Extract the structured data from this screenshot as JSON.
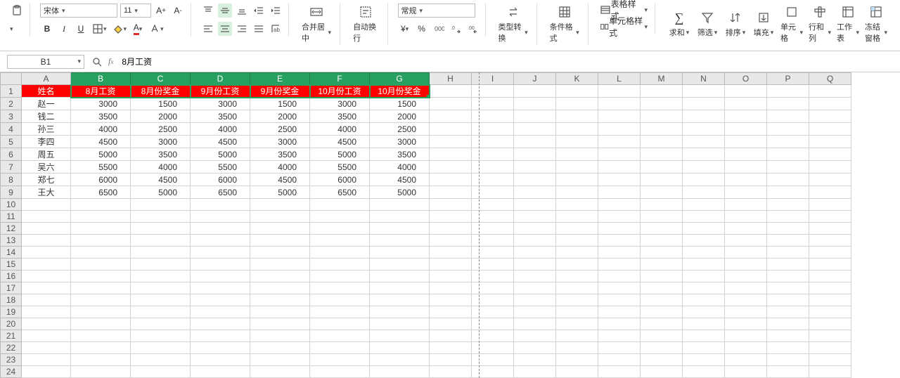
{
  "toolbar": {
    "font_name": "宋体",
    "font_size": "11",
    "number_format": "常规",
    "merge_center": "合并居中",
    "wrap_text": "自动换行",
    "type_convert": "类型转换",
    "cond_format": "条件格式",
    "table_style": "表格样式",
    "cell_style": "单元格样式",
    "sum": "求和",
    "filter": "筛选",
    "sort": "排序",
    "fill": "填充",
    "cell": "单元格",
    "row_col": "行和列",
    "worksheet": "工作表",
    "freeze": "冻结窗格"
  },
  "namebox": {
    "ref": "B1"
  },
  "formula": {
    "value": "8月工资"
  },
  "columns": [
    "A",
    "B",
    "C",
    "D",
    "E",
    "F",
    "G",
    "H",
    "I",
    "J",
    "K",
    "L",
    "M",
    "N",
    "O",
    "P",
    "Q"
  ],
  "headerRow": [
    "姓名",
    "8月工资",
    "8月份奖金",
    "9月份工资",
    "9月份奖金",
    "10月份工资",
    "10月份奖金"
  ],
  "rows": [
    {
      "name": "赵一",
      "v": [
        3000,
        1500,
        3000,
        1500,
        3000,
        1500
      ]
    },
    {
      "name": "钱二",
      "v": [
        3500,
        2000,
        3500,
        2000,
        3500,
        2000
      ]
    },
    {
      "name": "孙三",
      "v": [
        4000,
        2500,
        4000,
        2500,
        4000,
        2500
      ]
    },
    {
      "name": "李四",
      "v": [
        4500,
        3000,
        4500,
        3000,
        4500,
        3000
      ]
    },
    {
      "name": "周五",
      "v": [
        5000,
        3500,
        5000,
        3500,
        5000,
        3500
      ]
    },
    {
      "name": "吴六",
      "v": [
        5500,
        4000,
        5500,
        4000,
        5500,
        4000
      ]
    },
    {
      "name": "郑七",
      "v": [
        6000,
        4500,
        6000,
        4500,
        6000,
        4500
      ]
    },
    {
      "name": "王大",
      "v": [
        6500,
        5000,
        6500,
        5000,
        6500,
        5000
      ]
    }
  ],
  "selectedCols": [
    "B",
    "C",
    "D",
    "E",
    "F",
    "G"
  ],
  "emptyRows": 15,
  "chart_data": {
    "type": "table",
    "title": "",
    "columns": [
      "姓名",
      "8月工资",
      "8月份奖金",
      "9月份工资",
      "9月份奖金",
      "10月份工资",
      "10月份奖金"
    ],
    "data": [
      [
        "赵一",
        3000,
        1500,
        3000,
        1500,
        3000,
        1500
      ],
      [
        "钱二",
        3500,
        2000,
        3500,
        2000,
        3500,
        2000
      ],
      [
        "孙三",
        4000,
        2500,
        4000,
        2500,
        4000,
        2500
      ],
      [
        "李四",
        4500,
        3000,
        4500,
        3000,
        4500,
        3000
      ],
      [
        "周五",
        5000,
        3500,
        5000,
        3500,
        5000,
        3500
      ],
      [
        "吴六",
        5500,
        4000,
        5500,
        4000,
        5500,
        4000
      ],
      [
        "郑七",
        6000,
        4500,
        6000,
        4500,
        6000,
        4500
      ],
      [
        "王大",
        6500,
        5000,
        6500,
        5000,
        6500,
        5000
      ]
    ]
  }
}
